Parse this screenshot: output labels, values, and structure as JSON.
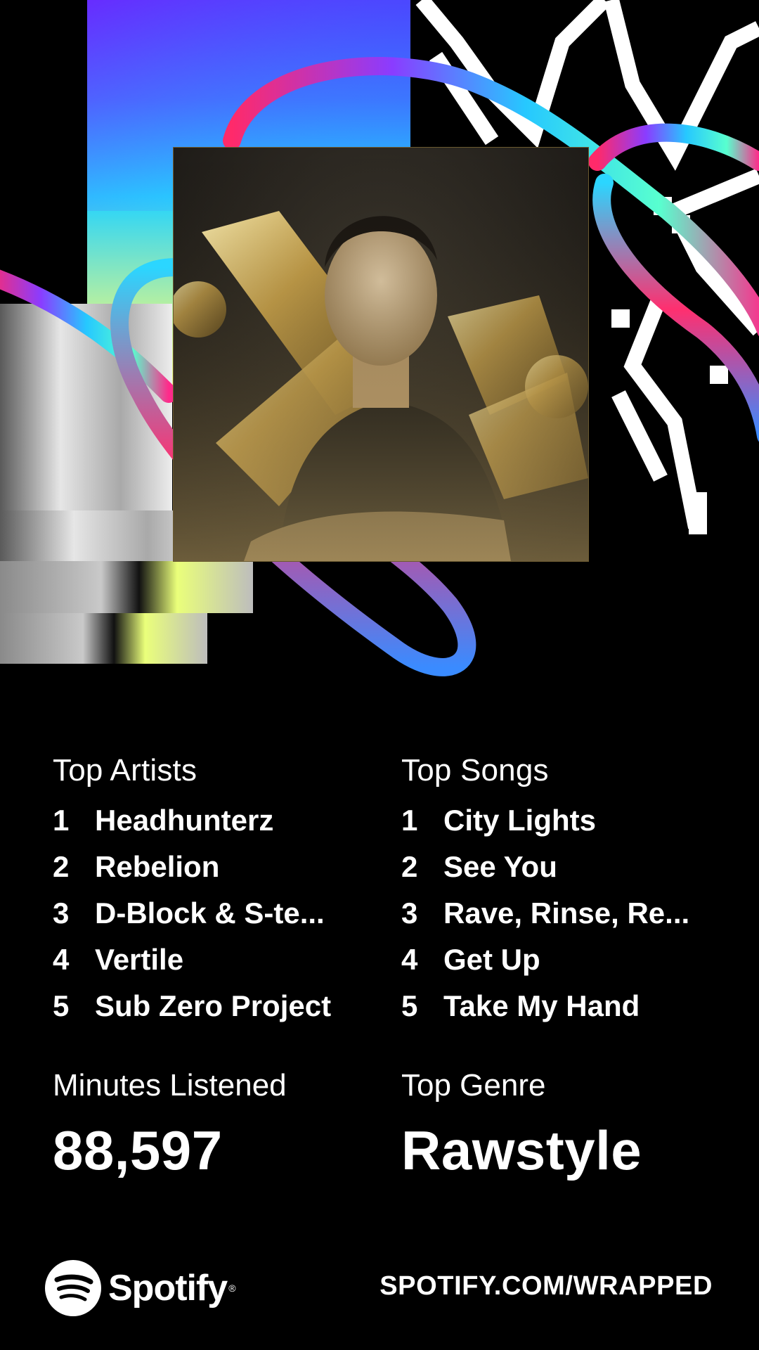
{
  "top_artists": {
    "title": "Top Artists",
    "items": [
      {
        "rank": "1",
        "name": "Headhunterz"
      },
      {
        "rank": "2",
        "name": "Rebelion"
      },
      {
        "rank": "3",
        "name": "D-Block & S-te..."
      },
      {
        "rank": "4",
        "name": "Vertile"
      },
      {
        "rank": "5",
        "name": "Sub Zero Project"
      }
    ]
  },
  "top_songs": {
    "title": "Top Songs",
    "items": [
      {
        "rank": "1",
        "name": "City Lights"
      },
      {
        "rank": "2",
        "name": "See You"
      },
      {
        "rank": "3",
        "name": "Rave, Rinse, Re..."
      },
      {
        "rank": "4",
        "name": "Get Up"
      },
      {
        "rank": "5",
        "name": "Take My Hand"
      }
    ]
  },
  "minutes_listened": {
    "label": "Minutes Listened",
    "value": "88,597"
  },
  "top_genre": {
    "label": "Top Genre",
    "value": "Rawstyle"
  },
  "footer": {
    "brand": "Spotify",
    "url": "SPOTIFY.COM/WRAPPED"
  },
  "colors": {
    "background": "#000000",
    "text": "#ffffff",
    "brand_logo": "#ffffff"
  },
  "icons": {
    "logo": "spotify-logo-icon",
    "artwork": "top-artist-photo"
  }
}
